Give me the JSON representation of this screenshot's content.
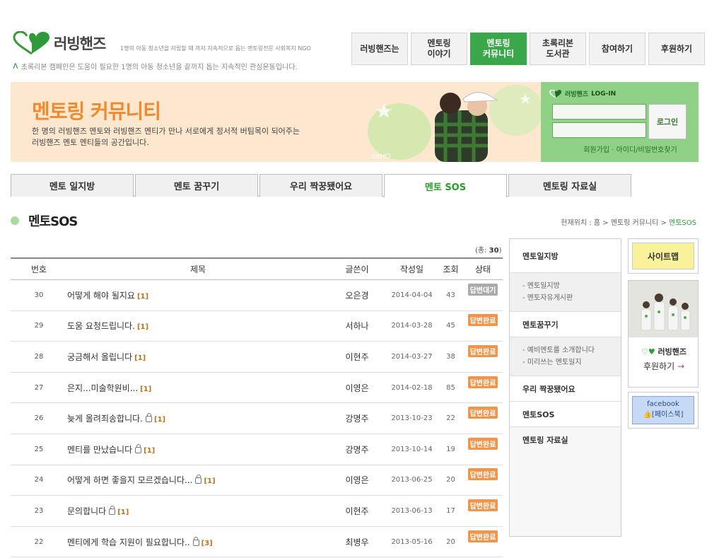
{
  "header": {
    "logo_text": "러빙핸즈",
    "tagline": "1명의 아동 청소년을 자립할 때 까지 지속적으로 돕는 멘토링전문 사회복지 NGO",
    "campaign": "초록리본 캠페인은 도움이 필요한 1명의 아동 청소년을 끝까지 돕는 지속적인 관심운동입니다.",
    "gnb": [
      {
        "label": "러빙핸즈는"
      },
      {
        "label": "멘토링\n이야기"
      },
      {
        "label": "멘토링\n커뮤니티"
      },
      {
        "label": "초록리본\n도서관"
      },
      {
        "label": "참여하기"
      },
      {
        "label": "후원하기"
      }
    ]
  },
  "banner": {
    "title": "멘토링 커뮤니티",
    "desc_line1": "한 명의 러빙핸즈 멘토와 러빙핸즈 멘티가 만나 서로에게 정서적 버팀목이 되어주는",
    "desc_line2": "러빙핸즈 멘토 멘티들의 공간입니다.",
    "cap_text": "YAHO"
  },
  "login": {
    "brand": "러빙핸즈",
    "heading": "LOG-IN",
    "button": "로그인",
    "links": "회원가입 · 아이디/비밀번호찾기"
  },
  "tabs": [
    {
      "label": "멘토 일지방"
    },
    {
      "label": "멘토 꿈꾸기"
    },
    {
      "label": "우리 짝꿍됐어요"
    },
    {
      "label": "멘토 SOS"
    },
    {
      "label": "멘토링 자료실"
    }
  ],
  "page": {
    "title": "멘토SOS",
    "breadcrumb_prefix": "현재위치 : 홈 > 멘토링 커뮤니티 > ",
    "breadcrumb_current": "멘토SOS"
  },
  "board": {
    "total_prefix": "(총: ",
    "total_count": "30",
    "total_suffix": ")",
    "columns": {
      "no": "번호",
      "title": "제목",
      "writer": "글쓴이",
      "date": "작성일",
      "views": "조회",
      "status": "상태"
    },
    "rows": [
      {
        "no": "30",
        "title": "어떻게 해야 될지요",
        "locked": false,
        "comments": "[1]",
        "writer": "오은경",
        "date": "2014-04-04",
        "views": "43",
        "status": "답변대기",
        "status_type": "wait"
      },
      {
        "no": "29",
        "title": "도움 요청드립니다.",
        "locked": false,
        "comments": "[1]",
        "writer": "서하나",
        "date": "2014-03-28",
        "views": "45",
        "status": "답변완료",
        "status_type": "done"
      },
      {
        "no": "28",
        "title": "궁금해서 올립니다",
        "locked": false,
        "comments": "[1]",
        "writer": "이현주",
        "date": "2014-03-27",
        "views": "38",
        "status": "답변완료",
        "status_type": "done"
      },
      {
        "no": "27",
        "title": " 은지...미술학원비...",
        "locked": false,
        "comments": "[1]",
        "writer": "이영은",
        "date": "2014-02-18",
        "views": "85",
        "status": "답변완료",
        "status_type": "done"
      },
      {
        "no": "26",
        "title": "늦게 올려죄송합니다.",
        "locked": true,
        "comments": "[1]",
        "writer": "강명주",
        "date": "2013-10-23",
        "views": "22",
        "status": "답변완료",
        "status_type": "done"
      },
      {
        "no": "25",
        "title": "멘티를 만났습니다",
        "locked": true,
        "comments": "[1]",
        "writer": "강명주",
        "date": "2013-10-14",
        "views": "19",
        "status": "답변완료",
        "status_type": "done"
      },
      {
        "no": "24",
        "title": "어떻게 하면 좋을지 모르겠습니다...",
        "locked": true,
        "comments": "[1]",
        "writer": "이영은",
        "date": "2013-06-25",
        "views": "20",
        "status": "답변완료",
        "status_type": "done"
      },
      {
        "no": "23",
        "title": "문의합니다",
        "locked": true,
        "comments": "[1]",
        "writer": "이현주",
        "date": "2013-06-13",
        "views": "17",
        "status": "답변완료",
        "status_type": "done"
      },
      {
        "no": "22",
        "title": "멘티에게 학습 지원이 필요합니다..",
        "locked": true,
        "comments": "[3]",
        "writer": "최병우",
        "date": "2013-05-16",
        "views": "20",
        "status": "답변완료",
        "status_type": "done"
      }
    ]
  },
  "side_menu": {
    "item1": "멘토일지방",
    "sub1": [
      "- 멘토일지방",
      "- 멘토자유게시판"
    ],
    "item2": "멘토꿈꾸기",
    "sub2": [
      "- 예비멘토를 소개합니다",
      "- 미리쓰는 멘토일지"
    ],
    "item3": "우리 짝꿍됐어요",
    "item4": "멘토SOS",
    "item5": "멘토링 자료실"
  },
  "widgets": {
    "sitemap": "사이트맵",
    "support_brand": "러빙핸즈",
    "support_go": "후원하기",
    "support_arrow": "→",
    "facebook_1": "facebook",
    "facebook_2": "[페이스북]"
  },
  "colors": {
    "accent_green": "#3aa84a",
    "banner_bg": "#fde7cf",
    "title_orange": "#f08a2e",
    "login_bg": "#8fd186"
  }
}
